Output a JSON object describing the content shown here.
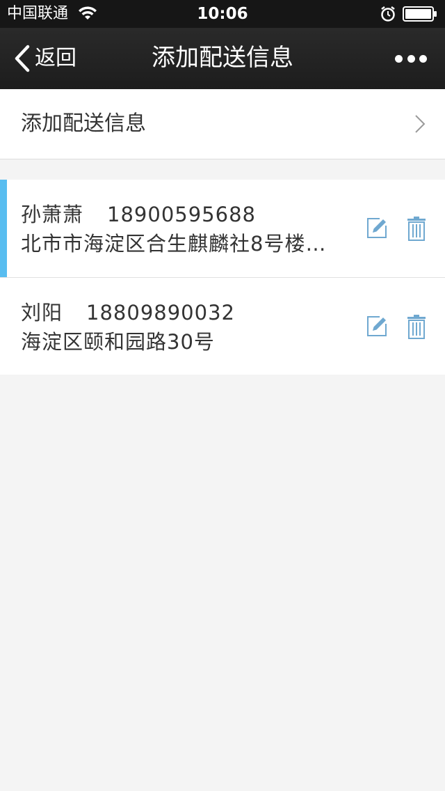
{
  "status_bar": {
    "carrier": "中国联通",
    "time": "10:06",
    "icons": [
      "wifi-icon",
      "alarm-icon",
      "battery-icon"
    ]
  },
  "nav_bar": {
    "back_label": "返回",
    "title": "添加配送信息",
    "more_icon": "more-dots-icon"
  },
  "add_row": {
    "label": "添加配送信息",
    "icon": "chevron-right-icon"
  },
  "addresses": [
    {
      "name": "孙萧萧",
      "phone": "18900595688",
      "address": "北市市海淀区合生麒麟社8号楼…",
      "selected": true
    },
    {
      "name": "刘阳",
      "phone": "18809890032",
      "address": "海淀区颐和园路30号",
      "selected": false
    }
  ],
  "colors": {
    "selected_indicator": "#58bdf0",
    "action_icon": "#6fa8d0",
    "nav_background": "#1d1d1d",
    "page_background": "#f4f4f4"
  }
}
